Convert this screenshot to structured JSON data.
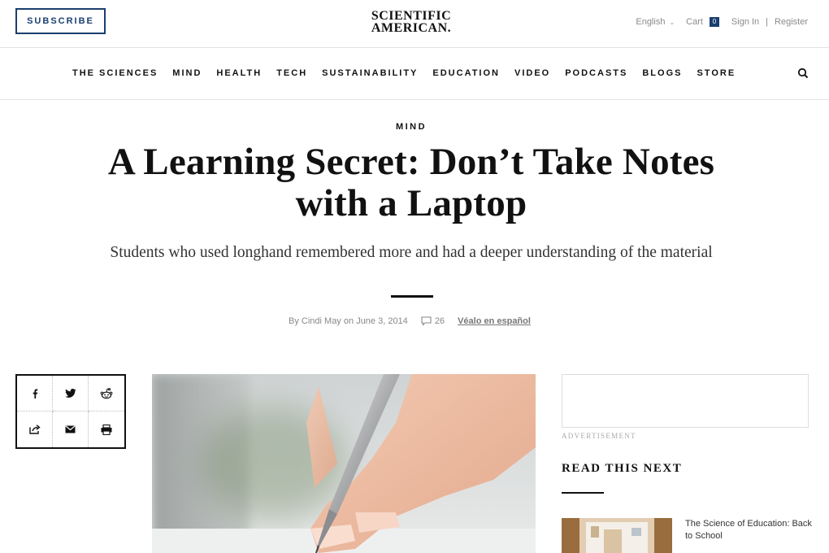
{
  "header": {
    "subscribe_label": "SUBSCRIBE",
    "logo_line1": "SCIENTIFIC",
    "logo_line2": "AMERICAN.",
    "language_label": "English",
    "cart_label": "Cart",
    "cart_count": "0",
    "signin_label": "Sign In",
    "separator": "|",
    "register_label": "Register",
    "brand_color": "#1a3e6f"
  },
  "nav": {
    "items": [
      {
        "label": "THE SCIENCES"
      },
      {
        "label": "MIND"
      },
      {
        "label": "HEALTH"
      },
      {
        "label": "TECH"
      },
      {
        "label": "SUSTAINABILITY"
      },
      {
        "label": "EDUCATION"
      },
      {
        "label": "VIDEO"
      },
      {
        "label": "PODCASTS"
      },
      {
        "label": "BLOGS"
      },
      {
        "label": "STORE"
      }
    ],
    "search_icon": "search-icon"
  },
  "article": {
    "kicker": "MIND",
    "headline": "A Learning Secret: Don’t Take Notes with a Laptop",
    "dek": "Students who used longhand remembered more and had a deeper understanding of the material",
    "byline_by": "By",
    "author": "Cindi May",
    "byline_on": "on",
    "date": "June 3, 2014",
    "comment_count": "26",
    "spanish_link": "Véalo en español"
  },
  "share": {
    "icons": [
      "facebook-icon",
      "twitter-icon",
      "reddit-icon",
      "share-icon",
      "email-icon",
      "print-icon"
    ]
  },
  "sidebar": {
    "ad_label": "ADVERTISEMENT",
    "read_next_heading": "READ THIS NEXT",
    "read_next_items": [
      {
        "title": "The Science of Education: Back to School"
      }
    ]
  }
}
